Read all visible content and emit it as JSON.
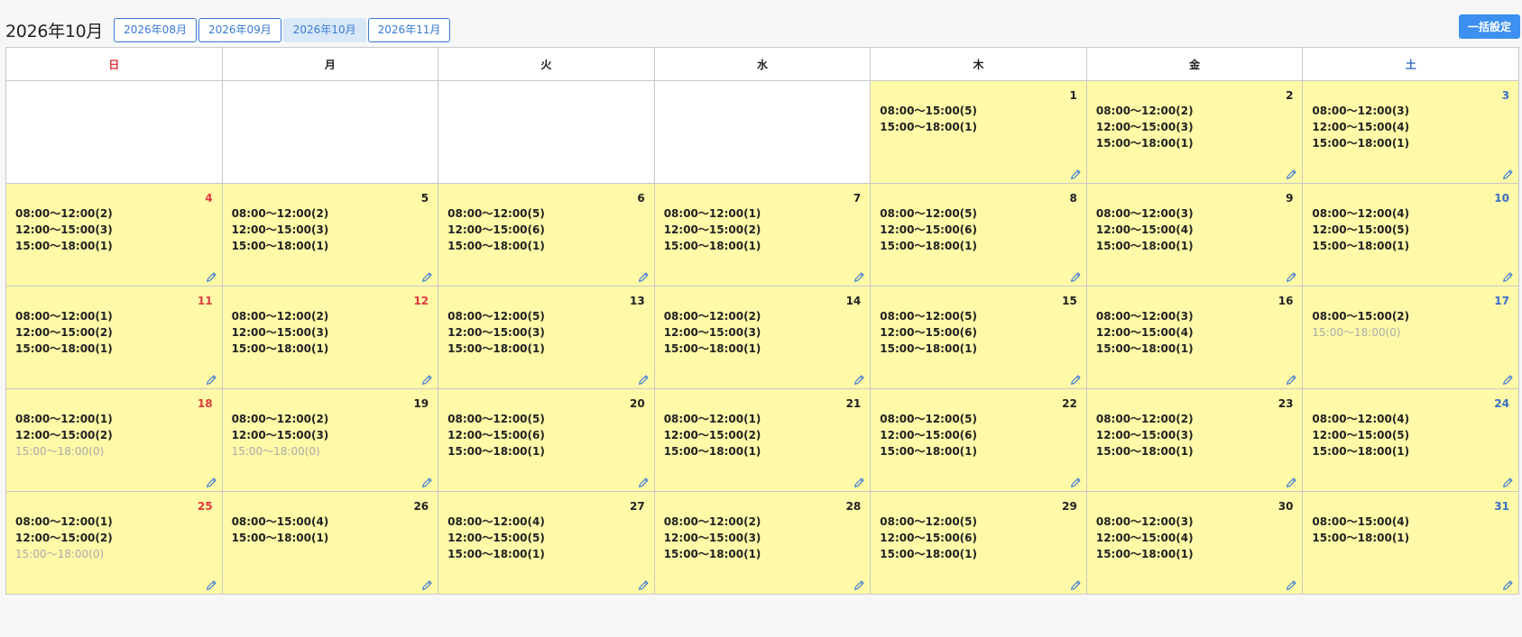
{
  "header": {
    "title": "2026年10月",
    "months": [
      {
        "label": "2026年08月",
        "active": false
      },
      {
        "label": "2026年09月",
        "active": false
      },
      {
        "label": "2026年10月",
        "active": true
      },
      {
        "label": "2026年11月",
        "active": false
      }
    ],
    "bulk_label": "一括設定"
  },
  "weekdays": [
    "日",
    "月",
    "火",
    "水",
    "木",
    "金",
    "土"
  ],
  "accent": "#3d8ff0",
  "cell_color": "#fffaa8",
  "edit_icon": "pencil-icon",
  "days": [
    {
      "day": "1",
      "slots": [
        {
          "text": "08:00〜15:00(5)",
          "zero": false
        },
        {
          "text": "15:00〜18:00(1)",
          "zero": false
        }
      ]
    },
    {
      "day": "2",
      "slots": [
        {
          "text": "08:00〜12:00(2)",
          "zero": false
        },
        {
          "text": "12:00〜15:00(3)",
          "zero": false
        },
        {
          "text": "15:00〜18:00(1)",
          "zero": false
        }
      ]
    },
    {
      "day": "3",
      "slots": [
        {
          "text": "08:00〜12:00(3)",
          "zero": false
        },
        {
          "text": "12:00〜15:00(4)",
          "zero": false
        },
        {
          "text": "15:00〜18:00(1)",
          "zero": false
        }
      ]
    },
    {
      "day": "4",
      "slots": [
        {
          "text": "08:00〜12:00(2)",
          "zero": false
        },
        {
          "text": "12:00〜15:00(3)",
          "zero": false
        },
        {
          "text": "15:00〜18:00(1)",
          "zero": false
        }
      ]
    },
    {
      "day": "5",
      "slots": [
        {
          "text": "08:00〜12:00(2)",
          "zero": false
        },
        {
          "text": "12:00〜15:00(3)",
          "zero": false
        },
        {
          "text": "15:00〜18:00(1)",
          "zero": false
        }
      ]
    },
    {
      "day": "6",
      "slots": [
        {
          "text": "08:00〜12:00(5)",
          "zero": false
        },
        {
          "text": "12:00〜15:00(6)",
          "zero": false
        },
        {
          "text": "15:00〜18:00(1)",
          "zero": false
        }
      ]
    },
    {
      "day": "7",
      "slots": [
        {
          "text": "08:00〜12:00(1)",
          "zero": false
        },
        {
          "text": "12:00〜15:00(2)",
          "zero": false
        },
        {
          "text": "15:00〜18:00(1)",
          "zero": false
        }
      ]
    },
    {
      "day": "8",
      "slots": [
        {
          "text": "08:00〜12:00(5)",
          "zero": false
        },
        {
          "text": "12:00〜15:00(6)",
          "zero": false
        },
        {
          "text": "15:00〜18:00(1)",
          "zero": false
        }
      ]
    },
    {
      "day": "9",
      "slots": [
        {
          "text": "08:00〜12:00(3)",
          "zero": false
        },
        {
          "text": "12:00〜15:00(4)",
          "zero": false
        },
        {
          "text": "15:00〜18:00(1)",
          "zero": false
        }
      ]
    },
    {
      "day": "10",
      "slots": [
        {
          "text": "08:00〜12:00(4)",
          "zero": false
        },
        {
          "text": "12:00〜15:00(5)",
          "zero": false
        },
        {
          "text": "15:00〜18:00(1)",
          "zero": false
        }
      ]
    },
    {
      "day": "11",
      "holiday": true,
      "slots": [
        {
          "text": "08:00〜12:00(1)",
          "zero": false
        },
        {
          "text": "12:00〜15:00(2)",
          "zero": false
        },
        {
          "text": "15:00〜18:00(1)",
          "zero": false
        }
      ]
    },
    {
      "day": "12",
      "holiday": true,
      "slots": [
        {
          "text": "08:00〜12:00(2)",
          "zero": false
        },
        {
          "text": "12:00〜15:00(3)",
          "zero": false
        },
        {
          "text": "15:00〜18:00(1)",
          "zero": false
        }
      ]
    },
    {
      "day": "13",
      "slots": [
        {
          "text": "08:00〜12:00(5)",
          "zero": false
        },
        {
          "text": "12:00〜15:00(3)",
          "zero": false
        },
        {
          "text": "15:00〜18:00(1)",
          "zero": false
        }
      ]
    },
    {
      "day": "14",
      "slots": [
        {
          "text": "08:00〜12:00(2)",
          "zero": false
        },
        {
          "text": "12:00〜15:00(3)",
          "zero": false
        },
        {
          "text": "15:00〜18:00(1)",
          "zero": false
        }
      ]
    },
    {
      "day": "15",
      "slots": [
        {
          "text": "08:00〜12:00(5)",
          "zero": false
        },
        {
          "text": "12:00〜15:00(6)",
          "zero": false
        },
        {
          "text": "15:00〜18:00(1)",
          "zero": false
        }
      ]
    },
    {
      "day": "16",
      "slots": [
        {
          "text": "08:00〜12:00(3)",
          "zero": false
        },
        {
          "text": "12:00〜15:00(4)",
          "zero": false
        },
        {
          "text": "15:00〜18:00(1)",
          "zero": false
        }
      ]
    },
    {
      "day": "17",
      "slots": [
        {
          "text": "08:00〜15:00(2)",
          "zero": false
        },
        {
          "text": "15:00〜18:00(0)",
          "zero": true
        }
      ]
    },
    {
      "day": "18",
      "slots": [
        {
          "text": "08:00〜12:00(1)",
          "zero": false
        },
        {
          "text": "12:00〜15:00(2)",
          "zero": false
        },
        {
          "text": "15:00〜18:00(0)",
          "zero": true
        }
      ]
    },
    {
      "day": "19",
      "slots": [
        {
          "text": "08:00〜12:00(2)",
          "zero": false
        },
        {
          "text": "12:00〜15:00(3)",
          "zero": false
        },
        {
          "text": "15:00〜18:00(0)",
          "zero": true
        }
      ]
    },
    {
      "day": "20",
      "slots": [
        {
          "text": "08:00〜12:00(5)",
          "zero": false
        },
        {
          "text": "12:00〜15:00(6)",
          "zero": false
        },
        {
          "text": "15:00〜18:00(1)",
          "zero": false
        }
      ]
    },
    {
      "day": "21",
      "slots": [
        {
          "text": "08:00〜12:00(1)",
          "zero": false
        },
        {
          "text": "12:00〜15:00(2)",
          "zero": false
        },
        {
          "text": "15:00〜18:00(1)",
          "zero": false
        }
      ]
    },
    {
      "day": "22",
      "slots": [
        {
          "text": "08:00〜12:00(5)",
          "zero": false
        },
        {
          "text": "12:00〜15:00(6)",
          "zero": false
        },
        {
          "text": "15:00〜18:00(1)",
          "zero": false
        }
      ]
    },
    {
      "day": "23",
      "slots": [
        {
          "text": "08:00〜12:00(2)",
          "zero": false
        },
        {
          "text": "12:00〜15:00(3)",
          "zero": false
        },
        {
          "text": "15:00〜18:00(1)",
          "zero": false
        }
      ]
    },
    {
      "day": "24",
      "slots": [
        {
          "text": "08:00〜12:00(4)",
          "zero": false
        },
        {
          "text": "12:00〜15:00(5)",
          "zero": false
        },
        {
          "text": "15:00〜18:00(1)",
          "zero": false
        }
      ]
    },
    {
      "day": "25",
      "slots": [
        {
          "text": "08:00〜12:00(1)",
          "zero": false
        },
        {
          "text": "12:00〜15:00(2)",
          "zero": false
        },
        {
          "text": "15:00〜18:00(0)",
          "zero": true
        }
      ]
    },
    {
      "day": "26",
      "slots": [
        {
          "text": "08:00〜15:00(4)",
          "zero": false
        },
        {
          "text": "15:00〜18:00(1)",
          "zero": false
        }
      ]
    },
    {
      "day": "27",
      "slots": [
        {
          "text": "08:00〜12:00(4)",
          "zero": false
        },
        {
          "text": "12:00〜15:00(5)",
          "zero": false
        },
        {
          "text": "15:00〜18:00(1)",
          "zero": false
        }
      ]
    },
    {
      "day": "28",
      "slots": [
        {
          "text": "08:00〜12:00(2)",
          "zero": false
        },
        {
          "text": "12:00〜15:00(3)",
          "zero": false
        },
        {
          "text": "15:00〜18:00(1)",
          "zero": false
        }
      ]
    },
    {
      "day": "29",
      "slots": [
        {
          "text": "08:00〜12:00(5)",
          "zero": false
        },
        {
          "text": "12:00〜15:00(6)",
          "zero": false
        },
        {
          "text": "15:00〜18:00(1)",
          "zero": false
        }
      ]
    },
    {
      "day": "30",
      "slots": [
        {
          "text": "08:00〜12:00(3)",
          "zero": false
        },
        {
          "text": "12:00〜15:00(4)",
          "zero": false
        },
        {
          "text": "15:00〜18:00(1)",
          "zero": false
        }
      ]
    },
    {
      "day": "31",
      "slots": [
        {
          "text": "08:00〜15:00(4)",
          "zero": false
        },
        {
          "text": "15:00〜18:00(1)",
          "zero": false
        }
      ]
    }
  ]
}
